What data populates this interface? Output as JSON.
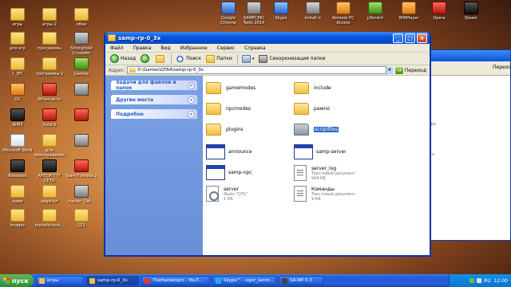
{
  "desktop": {
    "icons_left": [
      {
        "label": "игры",
        "kind": "folder"
      },
      {
        "label": "игры 2",
        "kind": "folder"
      },
      {
        "label": "обои",
        "kind": "folder"
      },
      {
        "label": "для игр",
        "kind": "folder"
      },
      {
        "label": "программы",
        "kind": "folder"
      },
      {
        "label": "Stronghold Crusader",
        "kind": "app"
      },
      {
        "label": "1_IBT",
        "kind": "folder"
      },
      {
        "label": "программы 2",
        "kind": "folder"
      },
      {
        "label": "Garena",
        "kind": "green"
      },
      {
        "label": "Q2",
        "kind": "orange"
      },
      {
        "label": "ВКонтакте",
        "kind": "red"
      },
      {
        "label": "",
        "kind": "app"
      },
      {
        "label": "WWII",
        "kind": "dark"
      },
      {
        "label": "Dota 2",
        "kind": "red"
      },
      {
        "label": "",
        "kind": "red"
      },
      {
        "label": "Microsoft Word",
        "kind": "doc"
      },
      {
        "label": "для монтирования",
        "kind": "folder"
      },
      {
        "label": "",
        "kind": "app"
      },
      {
        "label": "Reloaded",
        "kind": "dark"
      },
      {
        "label": "АНТОН ТУТ СЕТЬ",
        "kind": "dark"
      },
      {
        "label": "Team Fortress 2",
        "kind": "red"
      },
      {
        "label": "идеи",
        "kind": "folder"
      },
      {
        "label": "sdgsfdvf",
        "kind": "folder"
      },
      {
        "label": "Hacker_Det...",
        "kind": "app"
      },
      {
        "label": "images",
        "kind": "folder"
      },
      {
        "label": "metodichesk...",
        "kind": "folder"
      },
      {
        "label": "123",
        "kind": "folder"
      }
    ],
    "icons_top": [
      {
        "label": "Google Chrome",
        "kind": "blue"
      },
      {
        "label": "SAMPCMD Tools 2014",
        "kind": "app"
      },
      {
        "label": "Skype",
        "kind": "blue"
      },
      {
        "label": "Install ic",
        "kind": "app"
      },
      {
        "label": "Remote PC Access",
        "kind": "orange"
      },
      {
        "label": "µTorrent",
        "kind": "green"
      },
      {
        "label": "WMPlayer",
        "kind": "orange"
      },
      {
        "label": "Opera",
        "kind": "red"
      },
      {
        "label": "Steam",
        "kind": "dark"
      }
    ]
  },
  "background_window": {
    "go_label": "Переход",
    "text1": "rada)",
    "text2": "vers"
  },
  "window": {
    "title": "samp-rp-0_3x",
    "menu": [
      "Файл",
      "Правка",
      "Вид",
      "Избранное",
      "Сервис",
      "Справка"
    ],
    "toolbar": {
      "back": "Назад",
      "search": "Поиск",
      "folders": "Папки",
      "sync": "Синхронизация папки"
    },
    "address": {
      "label": "Адрес:",
      "path": "D:\\Games\\GTA4\\samp-rp-0_3x",
      "go": "Переход"
    },
    "task_panels": [
      {
        "label": "Задачи для файлов и папок"
      },
      {
        "label": "Другие места"
      },
      {
        "label": "Подробно"
      }
    ],
    "files": [
      {
        "name": "gamemodes",
        "type": "",
        "size": "",
        "icon": "folder"
      },
      {
        "name": "include",
        "type": "",
        "size": "",
        "icon": "folder"
      },
      {
        "name": "npcmodes",
        "type": "",
        "size": "",
        "icon": "folder"
      },
      {
        "name": "pawno",
        "type": "",
        "size": "",
        "icon": "folder"
      },
      {
        "name": "plugins",
        "type": "",
        "size": "",
        "icon": "folder"
      },
      {
        "name": "scriptfiles",
        "type": "",
        "size": "",
        "icon": "folder-gray"
      },
      {
        "name": "announce",
        "type": "",
        "size": "",
        "icon": "exe"
      },
      {
        "name": "samp-server",
        "type": "",
        "size": "",
        "icon": "exe"
      },
      {
        "name": "samp-npc",
        "type": "",
        "size": "",
        "icon": "exe"
      },
      {
        "name": "server_log",
        "type": "Текстовый документ",
        "size": "944 КБ",
        "icon": "txt"
      },
      {
        "name": "server",
        "type": "Файл \"CFG\"",
        "size": "1 КБ",
        "icon": "cfg"
      },
      {
        "name": "Команды",
        "type": "Текстовый документ",
        "size": "9 КБ",
        "icon": "txt"
      }
    ],
    "selected_file": "scriptfiles"
  },
  "taskbar": {
    "start": "пуск",
    "tasks": [
      {
        "label": "игры",
        "color": "#f1c34a"
      },
      {
        "label": "samp-rp-0_3x",
        "color": "#f1c34a"
      },
      {
        "label": "TheHackedpro - YouT...",
        "color": "#e33"
      },
      {
        "label": "Skype™ - egor_lamm...",
        "color": "#2aa7e8"
      },
      {
        "label": "SA-MP 0.3",
        "color": "#444"
      }
    ],
    "tray": {
      "lang": "RU",
      "time": "12:00"
    }
  },
  "colors": {
    "xp_blue": "#0a56e0",
    "selection": "#316ac5",
    "task_pane": "#6a8fd8"
  }
}
